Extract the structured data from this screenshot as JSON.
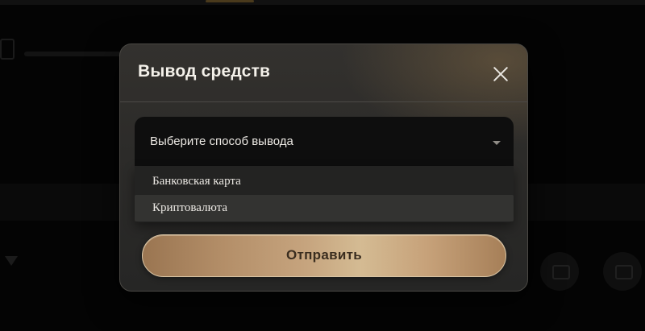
{
  "modal": {
    "title": "Вывод средств",
    "close_icon": "close-icon",
    "select": {
      "value": "Выберите способ вывода",
      "arrow_icon": "caret-down-icon"
    },
    "dropdown": {
      "options": [
        {
          "label": "Банковская карта"
        },
        {
          "label": "Криптовалюта",
          "highlighted": true
        }
      ]
    },
    "submit_label": "Отправить"
  },
  "colors": {
    "modal_background": "#2e2d2b",
    "select_background": "#0e0e0e",
    "dropdown_background": "#232322",
    "dropdown_highlight": "#333331",
    "button_gold": "#c6a47e",
    "button_text": "#3a2d1f",
    "title_text": "#f4f1ea"
  }
}
